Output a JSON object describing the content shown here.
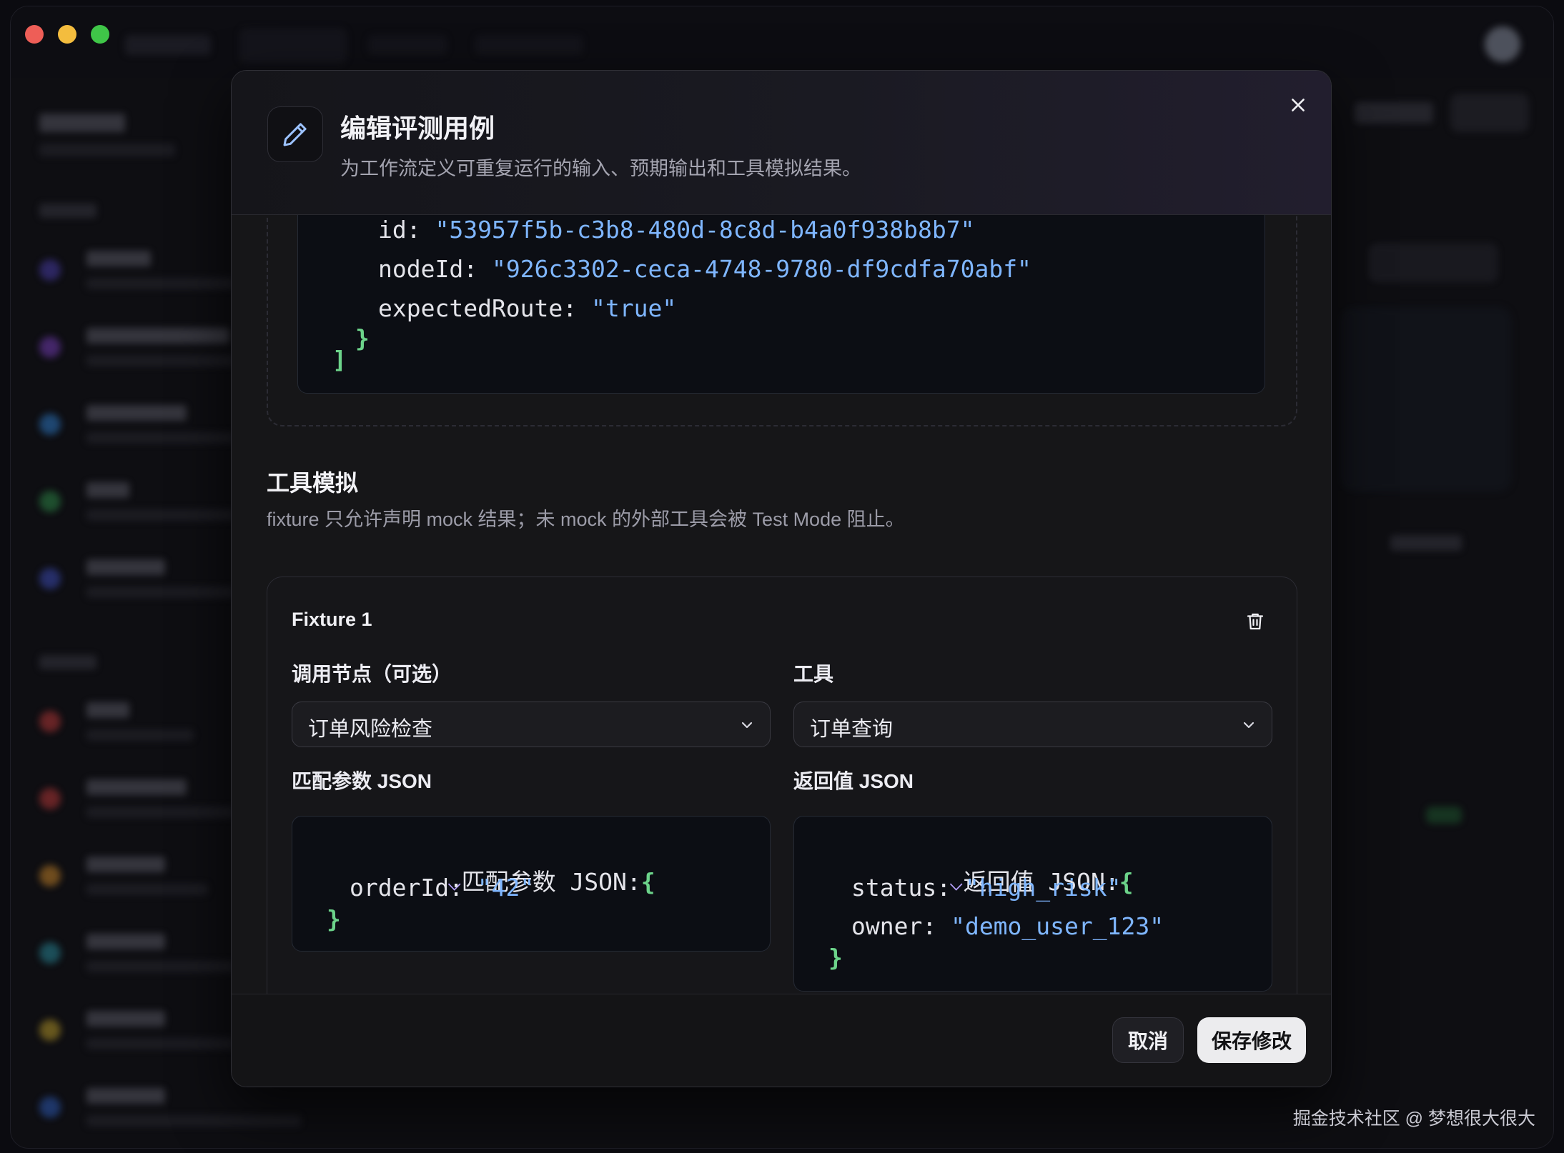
{
  "modal": {
    "title": "编辑评测用例",
    "subtitle": "为工作流定义可重复运行的输入、预期输出和工具模拟结果。",
    "header_icon": "pencil-icon",
    "close_icon": "close-icon"
  },
  "route_code": {
    "id_key": "id: ",
    "id_value": "\"53957f5b-c3b8-480d-8c8d-b4a0f938b8b7\"",
    "node_key": "nodeId: ",
    "node_value": "\"926c3302-ceca-4748-9780-df9cdfa70abf\"",
    "route_key": "expectedRoute: ",
    "route_value": "\"true\"",
    "close_brace": "}",
    "close_bracket": "]"
  },
  "tool_mock": {
    "title": "工具模拟",
    "description": "fixture 只允许声明 mock 结果；未 mock 的外部工具会被 Test Mode 阻止。"
  },
  "fixture": {
    "title": "Fixture 1",
    "delete_icon": "trash-icon",
    "node_label": "调用节点（可选）",
    "node_value": "订单风险检查",
    "tool_label": "工具",
    "tool_value": "订单查询",
    "match_label": "匹配参数 JSON",
    "return_label": "返回值 JSON",
    "match_code": {
      "caret": "⌵",
      "head": "匹配参数 JSON:",
      "open": "{",
      "key": "orderId: ",
      "value": "\"42\"",
      "close": "}"
    },
    "return_code": {
      "caret": "⌵",
      "head": "返回值 JSON:",
      "open": "{",
      "status_key": "status: ",
      "status_value": "\"high_risk\"",
      "owner_key": "owner: ",
      "owner_value": "\"demo_user_123\"",
      "close": "}"
    }
  },
  "footer": {
    "cancel": "取消",
    "save": "保存修改"
  },
  "watermark": "掘金技术社区 @ 梦想很大很大",
  "colors": {
    "string": "#7fb6ff",
    "brace": "#6cd38a",
    "caret": "#b8a2ff",
    "save_bg": "#ececee"
  }
}
